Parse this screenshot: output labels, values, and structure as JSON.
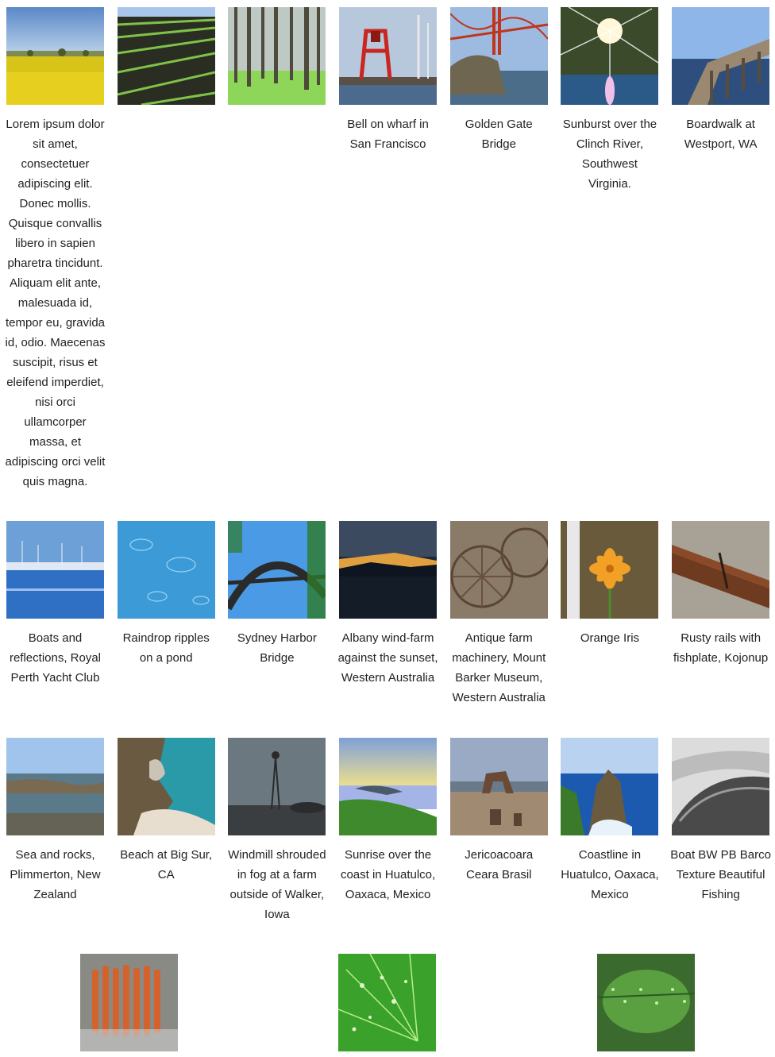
{
  "gallery": {
    "row1": [
      {
        "icon": "canola-field-photo",
        "caption": "Lorem ipsum dolor sit amet, consectetuer adipiscing elit. Donec mollis. Quisque convallis libero in sapien pharetra tincidunt. Aliquam elit ante, malesuada id, tempor eu, gravida id, odio. Maecenas suscipit, risus et eleifend imperdiet, nisi orci ullamcorper massa, et adipiscing orci velit quis magna."
      },
      {
        "icon": "crop-rows-photo",
        "caption": ""
      },
      {
        "icon": "pine-forest-photo",
        "caption": ""
      },
      {
        "icon": "wharf-bell-photo",
        "caption": "Bell on wharf in San Francisco"
      },
      {
        "icon": "golden-gate-photo",
        "caption": "Golden Gate Bridge"
      },
      {
        "icon": "sunburst-river-photo",
        "caption": "Sunburst over the Clinch River, Southwest Virginia."
      },
      {
        "icon": "boardwalk-photo",
        "caption": "Boardwalk at Westport, WA"
      }
    ],
    "row2": [
      {
        "icon": "yacht-club-photo",
        "caption": "Boats and reflections, Royal Perth Yacht Club"
      },
      {
        "icon": "raindrop-ripples-photo",
        "caption": "Raindrop ripples on a pond"
      },
      {
        "icon": "sydney-harbor-photo",
        "caption": "Sydney Harbor Bridge"
      },
      {
        "icon": "albany-sunset-photo",
        "caption": "Albany wind-farm against the sunset, Western Australia"
      },
      {
        "icon": "farm-machinery-photo",
        "caption": "Antique farm machinery, Mount Barker Museum, Western Australia"
      },
      {
        "icon": "orange-iris-photo",
        "caption": "Orange Iris"
      },
      {
        "icon": "rusty-rails-photo",
        "caption": "Rusty rails with fishplate, Kojonup"
      }
    ],
    "row3": [
      {
        "icon": "sea-rocks-photo",
        "caption": "Sea and rocks, Plimmerton, New Zealand"
      },
      {
        "icon": "big-sur-photo",
        "caption": "Beach at Big Sur, CA"
      },
      {
        "icon": "windmill-fog-photo",
        "caption": "Windmill shrouded in fog at a farm outside of Walker, Iowa"
      },
      {
        "icon": "huatulco-sunrise-photo",
        "caption": "Sunrise over the coast in Huatulco, Oaxaca, Mexico"
      },
      {
        "icon": "jericoacoara-photo",
        "caption": "Jericoacoara Ceara Brasil"
      },
      {
        "icon": "huatulco-coastline-photo",
        "caption": "Coastline in Huatulco, Oaxaca, Mexico"
      },
      {
        "icon": "boat-bw-photo",
        "caption": "Boat BW PB Barco Texture Beautiful Fishing"
      }
    ],
    "row4": [
      {
        "icon": "coral-texture-photo"
      },
      {
        "icon": "leaf-droplets-photo"
      },
      {
        "icon": "fern-dew-photo"
      }
    ]
  }
}
